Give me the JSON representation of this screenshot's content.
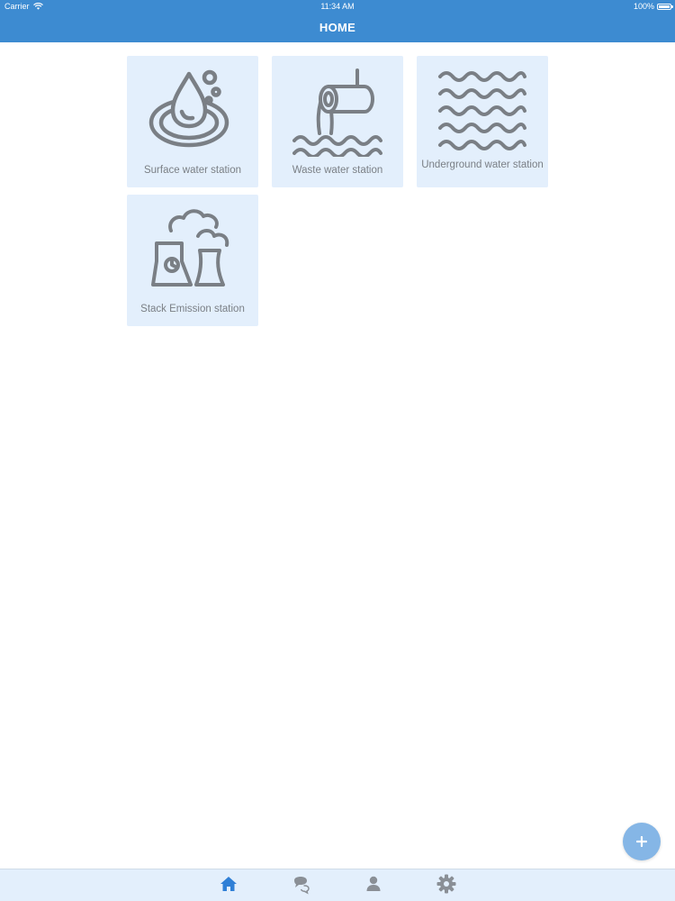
{
  "status_bar": {
    "carrier": "Carrier",
    "time": "11:34 AM",
    "battery": "100%",
    "icons": [
      "wifi-icon",
      "battery-icon"
    ]
  },
  "nav": {
    "title": "HOME"
  },
  "stations": [
    {
      "label": "Surface water station",
      "icon": "water-drop-icon"
    },
    {
      "label": "Waste water station",
      "icon": "pipe-outflow-icon"
    },
    {
      "label": "Underground water station",
      "icon": "waves-icon"
    },
    {
      "label": "Stack Emission station",
      "icon": "power-plant-icon"
    }
  ],
  "fab": {
    "icon": "plus-icon"
  },
  "tab_bar": {
    "items": [
      {
        "icon": "home-icon",
        "active": true
      },
      {
        "icon": "chat-icon",
        "active": false
      },
      {
        "icon": "user-icon",
        "active": false
      },
      {
        "icon": "gear-icon",
        "active": false
      }
    ]
  },
  "colors": {
    "primary": "#3d8bd1",
    "tile_background": "#e3effc",
    "icon_stroke": "#7a7f85",
    "fab": "#85b6e6",
    "tab_active": "#2f7fd6",
    "tab_inactive": "#8a8f96"
  }
}
